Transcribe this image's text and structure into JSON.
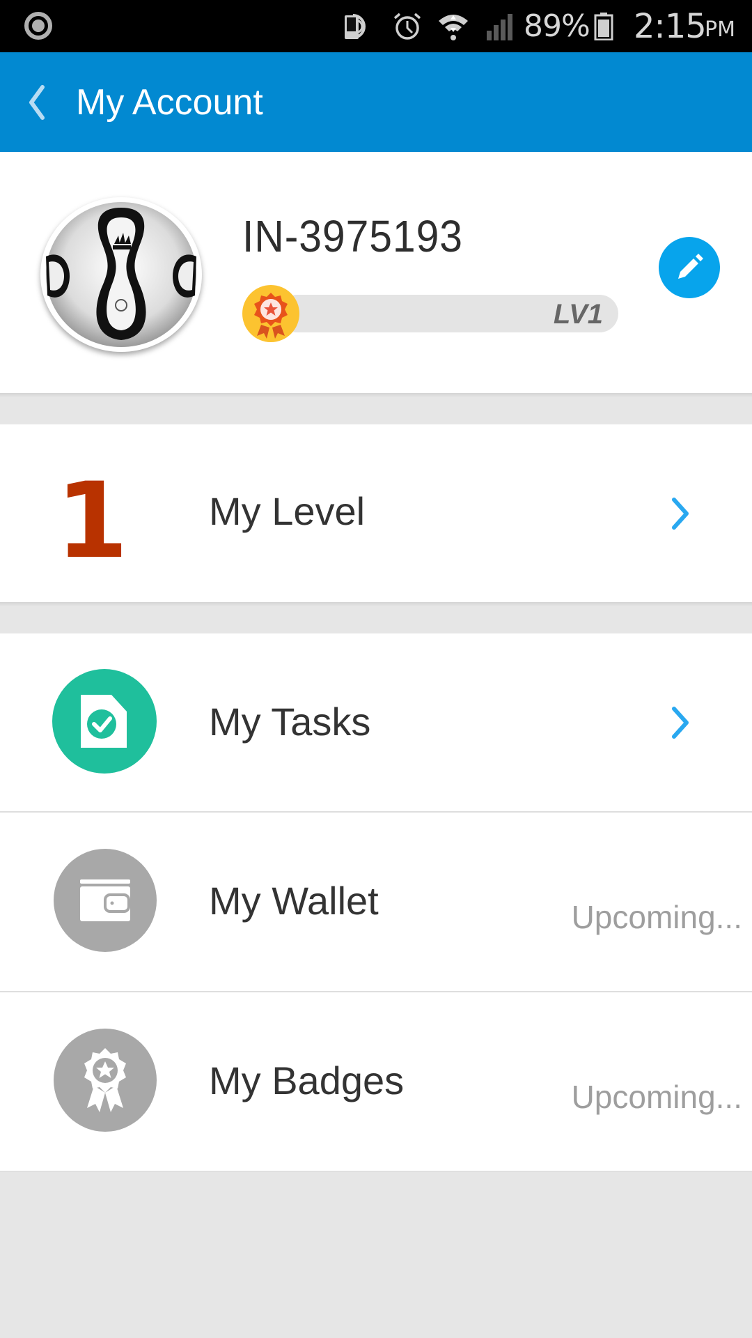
{
  "status_bar": {
    "left_icon": "ring-indicator-icon",
    "icons": [
      "nfc-icon",
      "alarm-icon",
      "wifi-icon",
      "signal-icon",
      "battery-icon"
    ],
    "battery_percent": "89%",
    "time": "2:15",
    "ampm": "PM"
  },
  "app_bar": {
    "back_icon": "back-chevron-icon",
    "title": "My Account",
    "color": "#0289d1"
  },
  "profile": {
    "avatar_icon": "soccer-ball-avatar",
    "user_id": "IN-3975193",
    "level_label": "LV1",
    "level_progress": 0,
    "medal_icon": "medal-icon",
    "edit_icon": "pencil-icon",
    "edit_color": "#07a4ec"
  },
  "menu": {
    "level": {
      "value": "1",
      "label": "My Level",
      "value_color": "#b83200"
    },
    "tasks": {
      "label": "My Tasks",
      "icon": "task-check-icon",
      "icon_color": "#1fbf9c"
    },
    "wallet": {
      "label": "My Wallet",
      "icon": "wallet-icon",
      "icon_color": "#a8a8a8",
      "status": "Upcoming..."
    },
    "badges": {
      "label": "My Badges",
      "icon": "badge-ribbon-icon",
      "icon_color": "#a8a8a8",
      "status": "Upcoming..."
    },
    "chevron_color": "#29a8f0"
  }
}
